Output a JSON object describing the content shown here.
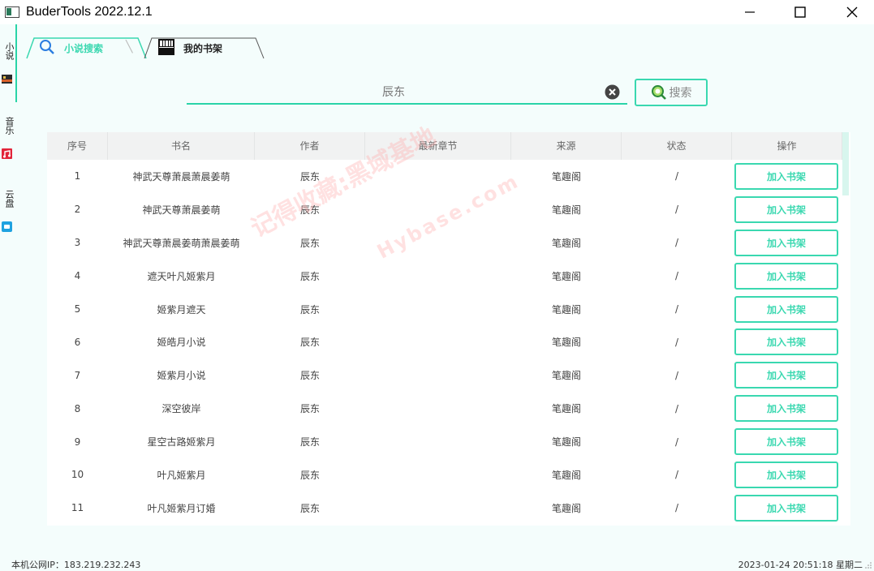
{
  "window": {
    "title": "BuderTools 2022.12.1"
  },
  "sidebar": {
    "items": [
      {
        "label": "小说",
        "icon": "novel-icon"
      },
      {
        "label": "音乐",
        "icon": "music-icon"
      },
      {
        "label": "云盘",
        "icon": "cloud-icon"
      }
    ]
  },
  "tabs": [
    {
      "label": "小说搜索",
      "icon": "search-icon",
      "active": true
    },
    {
      "label": "我的书架",
      "icon": "bookshelf-icon",
      "active": false
    }
  ],
  "search": {
    "placeholder": "辰东",
    "button_label": "搜索"
  },
  "table": {
    "columns": [
      "序号",
      "书名",
      "作者",
      "最新章节",
      "来源",
      "状态",
      "操作"
    ],
    "action_label": "加入书架",
    "rows": [
      {
        "index": "1",
        "title": "神武天尊萧晨萧晨姜萌",
        "author": "辰东",
        "latest": "",
        "source": "笔趣阁",
        "status": "/"
      },
      {
        "index": "2",
        "title": "神武天尊萧晨姜萌",
        "author": "辰东",
        "latest": "",
        "source": "笔趣阁",
        "status": "/"
      },
      {
        "index": "3",
        "title": "神武天尊萧晨姜萌萧晨姜萌",
        "author": "辰东",
        "latest": "",
        "source": "笔趣阁",
        "status": "/"
      },
      {
        "index": "4",
        "title": "遮天叶凡姬紫月",
        "author": "辰东",
        "latest": "",
        "source": "笔趣阁",
        "status": "/"
      },
      {
        "index": "5",
        "title": "姬紫月遮天",
        "author": "辰东",
        "latest": "",
        "source": "笔趣阁",
        "status": "/"
      },
      {
        "index": "6",
        "title": "姬皓月小说",
        "author": "辰东",
        "latest": "",
        "source": "笔趣阁",
        "status": "/"
      },
      {
        "index": "7",
        "title": "姬紫月小说",
        "author": "辰东",
        "latest": "",
        "source": "笔趣阁",
        "status": "/"
      },
      {
        "index": "8",
        "title": "深空彼岸",
        "author": "辰东",
        "latest": "",
        "source": "笔趣阁",
        "status": "/"
      },
      {
        "index": "9",
        "title": "星空古路姬紫月",
        "author": "辰东",
        "latest": "",
        "source": "笔趣阁",
        "status": "/"
      },
      {
        "index": "10",
        "title": "叶凡姬紫月",
        "author": "辰东",
        "latest": "",
        "source": "笔趣阁",
        "status": "/"
      },
      {
        "index": "11",
        "title": "叶凡姬紫月订婚",
        "author": "辰东",
        "latest": "",
        "source": "笔趣阁",
        "status": "/"
      }
    ]
  },
  "watermark": {
    "text": "记得收藏:黑域基地",
    "text2": "Hybase.com"
  },
  "status": {
    "ip_label": "本机公网IP：183.219.232.243",
    "datetime": "2023-01-24 20:51:18 星期二"
  },
  "colors": {
    "accent": "#3ad8b0",
    "background": "#f4fdfc"
  }
}
